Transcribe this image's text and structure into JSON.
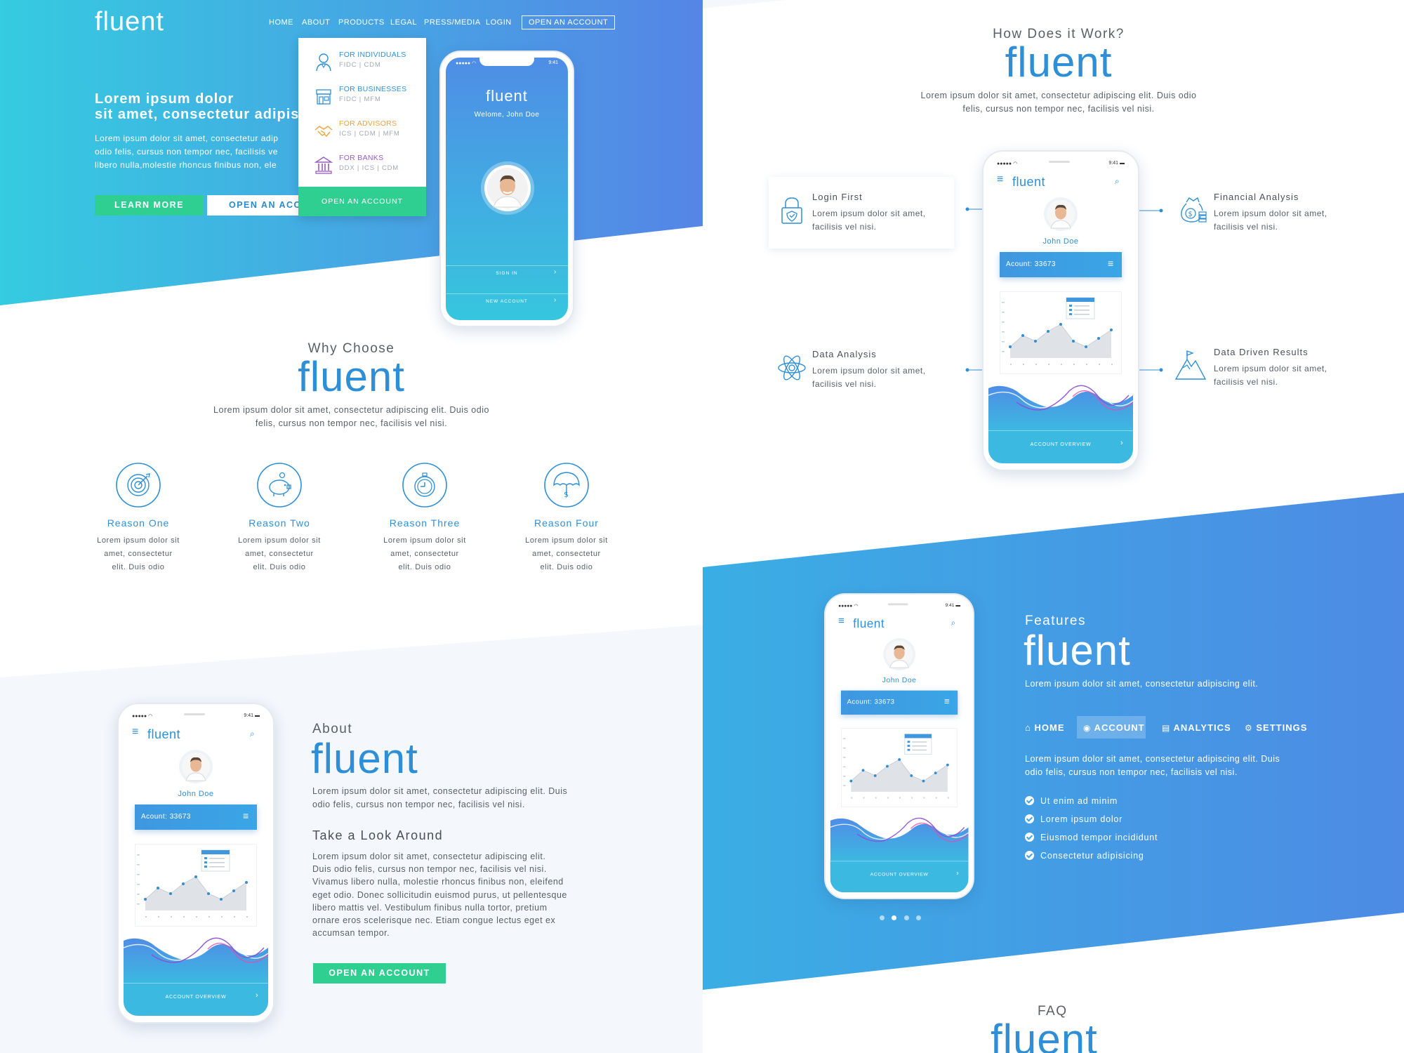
{
  "brand": {
    "logo": "fluent"
  },
  "nav": {
    "items": [
      "HOME",
      "ABOUT",
      "PRODUCTS",
      "LEGAL",
      "PRESS/MEDIA",
      "LOGIN"
    ],
    "cta": "OPEN AN ACCOUNT"
  },
  "dropdown": {
    "items": [
      {
        "title": "FOR INDIVIDUALS",
        "sub": "FIDC | CDM",
        "color": "#2f8fd6",
        "icon": "user-icon"
      },
      {
        "title": "FOR BUSINESSES",
        "sub": "FIDC | MFM",
        "color": "#2f8fd6",
        "icon": "store-icon"
      },
      {
        "title": "FOR ADVISORS",
        "sub": "ICS | CDM | MFM",
        "color": "#f0a23a",
        "icon": "handshake-icon"
      },
      {
        "title": "FOR BANKS",
        "sub": "DDX | ICS | CDM",
        "color": "#9b5bc4",
        "icon": "bank-icon"
      }
    ],
    "cta": "OPEN AN ACCOUNT"
  },
  "hero": {
    "title_line1": "Lorem ipsum dolor",
    "title_line2": "sit amet, consectetur adipis",
    "body_line1": "Lorem ipsum dolor sit amet, consectetur adip",
    "body_line2": "odio felis, cursus non tempor nec, facilisis ve",
    "body_line3": "libero nulla,molestie rhoncus finibus non, ele",
    "learn_more": "LEARN MORE",
    "open_account": "OPEN AN ACCO"
  },
  "hero_phone": {
    "status_time": "9:41",
    "app_name": "fluent",
    "welcome": "Welome, John Doe",
    "sign_in": "SIGN IN",
    "new_account": "NEW ACCOUNT"
  },
  "why": {
    "small": "Why Choose",
    "big": "fluent",
    "text_line1": "Lorem ipsum dolor sit amet, consectetur adipiscing elit. Duis odio",
    "text_line2": "felis, cursus non tempor nec, facilisis vel nisi.",
    "reasons": [
      {
        "title": "Reason One",
        "l1": "Lorem ipsum dolor sit",
        "l2": "amet, consectetur",
        "l3": "elit. Duis odio",
        "icon": "target-icon"
      },
      {
        "title": "Reason Two",
        "l1": "Lorem ipsum dolor sit",
        "l2": "amet, consectetur",
        "l3": "elit. Duis odio",
        "icon": "piggy-bank-icon"
      },
      {
        "title": "Reason Three",
        "l1": "Lorem ipsum dolor sit",
        "l2": "amet, consectetur",
        "l3": "elit. Duis odio",
        "icon": "stopwatch-icon"
      },
      {
        "title": "Reason Four",
        "l1": "Lorem ipsum dolor sit",
        "l2": "amet, consectetur",
        "l3": "elit. Duis odio",
        "icon": "umbrella-dollar-icon"
      }
    ]
  },
  "about": {
    "small": "About",
    "big": "fluent",
    "text_line1": "Lorem ipsum dolor sit amet, consectetur adipiscing elit. Duis",
    "text_line2": "odio felis, cursus non tempor nec, facilisis vel nisi.",
    "look_title": "Take a Look Around",
    "look_lines": [
      "Lorem ipsum dolor sit amet, consectetur adipiscing elit.",
      "Duis odio felis, cursus non tempor nec, facilisis vel nisi.",
      "Vivamus libero nulla, molestie rhoncus finibus non, eleifend",
      "eget odio. Donec sollicitudin euismod purus, ut pellentesque",
      "libero mattis vel. Vestibulum finibus nulla tortor, pretium",
      "ornare eros scelerisque nec. Etiam congue lectus eget ex",
      "accumsan tempor."
    ],
    "cta": "OPEN AN ACCOUNT"
  },
  "app_phone": {
    "status_time": "9:41",
    "app_name": "fluent",
    "user": "John Doe",
    "account": "Acount: 33673",
    "overview": "ACCOUNT OVERVIEW"
  },
  "how": {
    "small": "How Does it Work?",
    "big": "fluent",
    "text_line1": "Lorem ipsum dolor sit amet, consectetur adipiscing elit. Duis odio",
    "text_line2": "felis, cursus non tempor nec, facilisis vel nisi.",
    "features": [
      {
        "title": "Login First",
        "l1": "Lorem ipsum dolor sit amet,",
        "l2": "facilisis vel nisi.",
        "icon": "lock-shield-icon"
      },
      {
        "title": "Financial Analysis",
        "l1": "Lorem ipsum dolor sit amet,",
        "l2": "facilisis vel nisi.",
        "icon": "money-bag-icon"
      },
      {
        "title": "Data Analysis",
        "l1": "Lorem ipsum dolor sit amet,",
        "l2": "facilisis vel nisi.",
        "icon": "atom-icon"
      },
      {
        "title": "Data Driven Results",
        "l1": "Lorem ipsum dolor sit amet,",
        "l2": "facilisis vel nisi.",
        "icon": "mountain-flag-icon"
      }
    ]
  },
  "features": {
    "small": "Features",
    "big": "fluent",
    "tagline": "Lorem ipsum dolor sit amet, consectetur adipiscing elit.",
    "tabs": [
      "HOME",
      "ACCOUNT",
      "ANALYTICS",
      "SETTINGS"
    ],
    "text_line1": "Lorem ipsum dolor sit amet, consectetur adipiscing elit. Duis",
    "text_line2": "odio felis, cursus non tempor nec, facilisis vel nisi.",
    "checks": [
      "Ut enim ad minim",
      "Lorem ipsum dolor",
      "Eiusmod tempor incididunt",
      "Consectetur adipisicing"
    ]
  },
  "faq": {
    "small": "FAQ",
    "big": "fluent"
  },
  "colors": {
    "gradient_start": "#35cbe0",
    "gradient_end": "#5585e6",
    "accent_blue": "#2f8fd6",
    "accent_green": "#2fcf92",
    "panel_bg": "#f4f7fb"
  }
}
